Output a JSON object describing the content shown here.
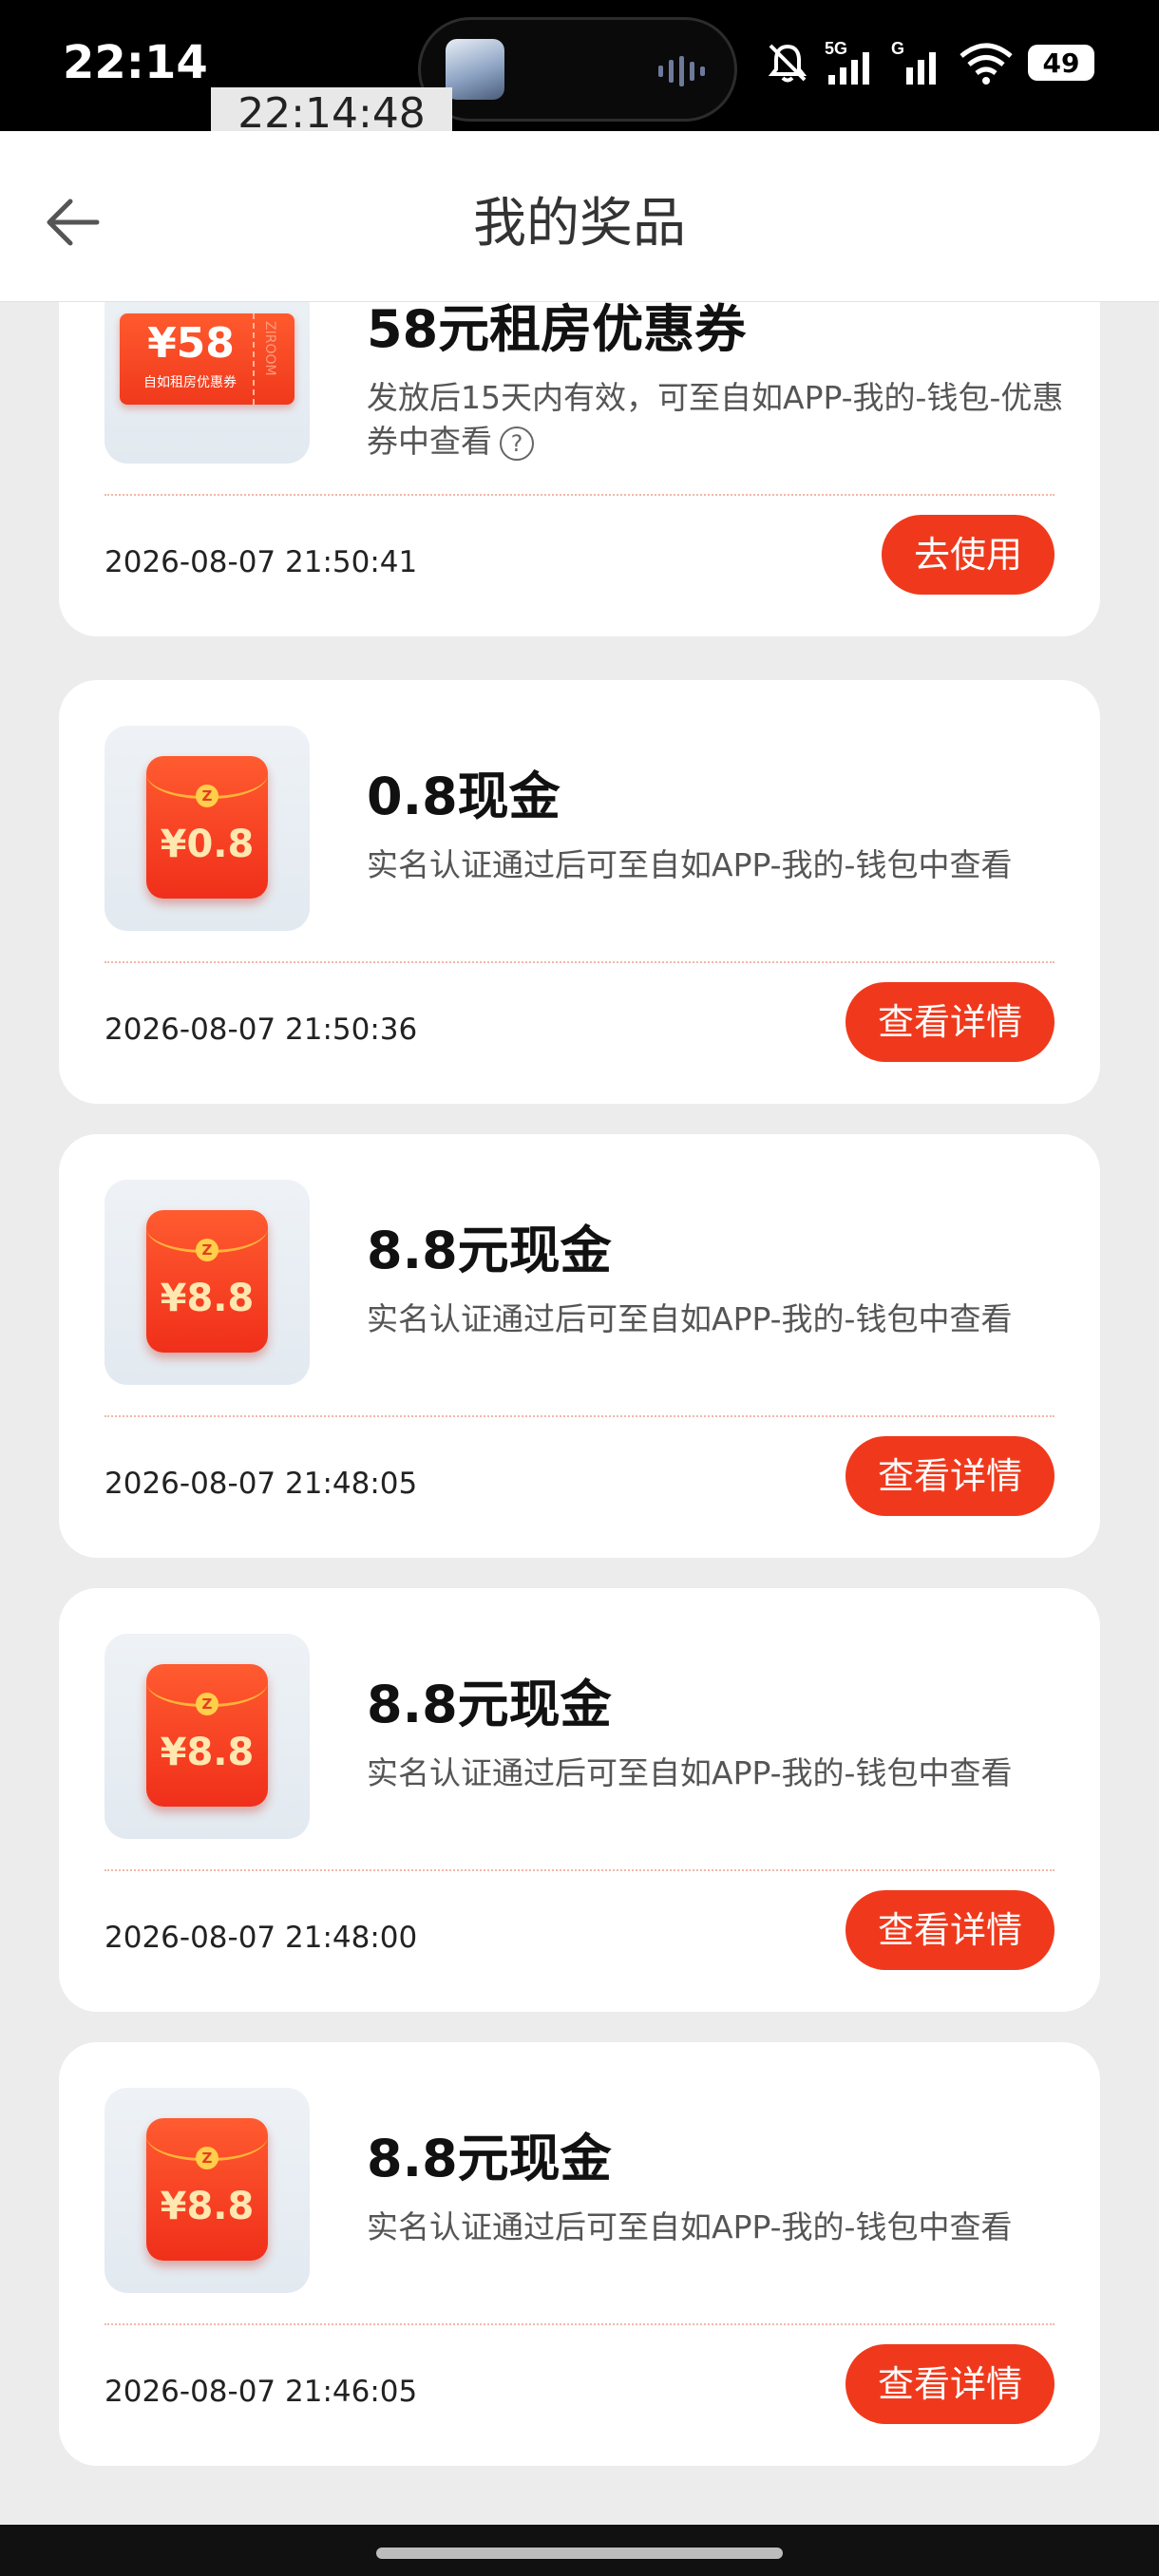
{
  "status_bar": {
    "time": "22:14",
    "network": "5G",
    "network2": "G",
    "battery": "49",
    "overlay_clock": "22:14:48"
  },
  "header": {
    "title": "我的奖品"
  },
  "prizes": [
    {
      "title": "58元租房优惠券",
      "thumb_amount": "¥58",
      "thumb_sub": "自如租房优惠券",
      "thumb_stub": "ZIROOM",
      "description": "发放后15天内有效，可至自如APP-我的-钱包-优惠券中查看",
      "timestamp": "2026-08-07 21:50:41",
      "action": "去使用"
    },
    {
      "title": "0.8现金",
      "thumb_amount": "¥0.8",
      "description": "实名认证通过后可至自如APP-我的-钱包中查看",
      "timestamp": "2026-08-07 21:50:36",
      "action": "查看详情"
    },
    {
      "title": "8.8元现金",
      "thumb_amount": "¥8.8",
      "description": "实名认证通过后可至自如APP-我的-钱包中查看",
      "timestamp": "2026-08-07 21:48:05",
      "action": "查看详情"
    },
    {
      "title": "8.8元现金",
      "thumb_amount": "¥8.8",
      "description": "实名认证通过后可至自如APP-我的-钱包中查看",
      "timestamp": "2026-08-07 21:48:00",
      "action": "查看详情"
    },
    {
      "title": "8.8元现金",
      "thumb_amount": "¥8.8",
      "description": "实名认证通过后可至自如APP-我的-钱包中查看",
      "timestamp": "2026-08-07 21:46:05",
      "action": "查看详情"
    }
  ],
  "colors": {
    "accent": "#f0391c",
    "background": "#ececec",
    "card": "#ffffff"
  },
  "icons": {
    "back": "arrow-left-icon",
    "help": "question-circle-icon",
    "mute": "bell-off-icon",
    "wifi": "wifi-icon",
    "signal": "signal-icon"
  }
}
